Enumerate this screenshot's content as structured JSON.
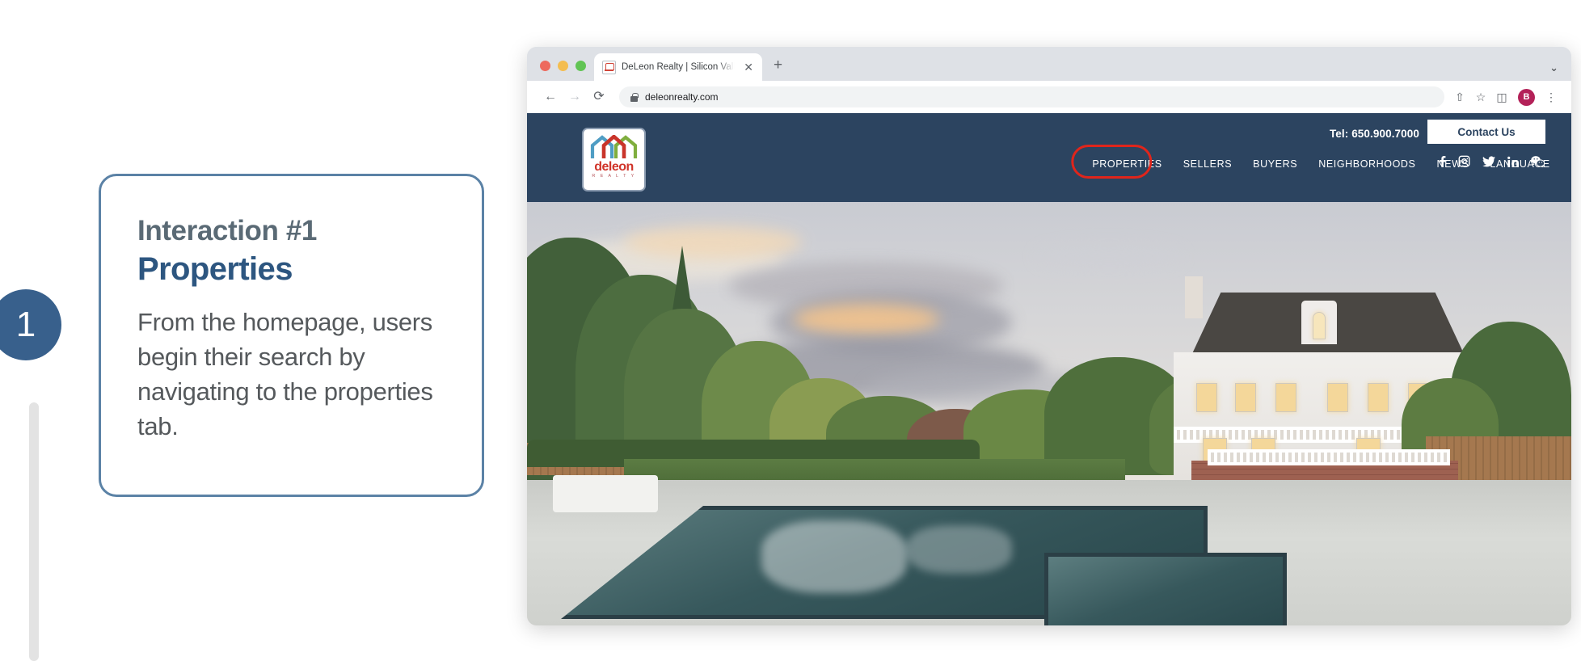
{
  "callout": {
    "badge_number": "1",
    "eyebrow": "Interaction #1",
    "title": "Properties",
    "body": "From the homepage, users begin their search by navigating to the properties tab.",
    "accent_color": "#38608c",
    "border_color": "#5b82a6",
    "title_color": "#2d5680"
  },
  "browser": {
    "traffic_lights": [
      "close",
      "minimize",
      "maximize"
    ],
    "tab": {
      "title": "DeLeon Realty | Silicon Valley R",
      "favicon": "deleon-favicon",
      "close_label": "✕"
    },
    "new_tab_label": "+",
    "tabstrip_chevron": "⌄",
    "toolbar": {
      "back_label": "←",
      "forward_label": "→",
      "reload_label": "⟳",
      "lock_icon": "lock-icon",
      "url": "deleonrealty.com",
      "share_label": "⇧",
      "bookmark_label": "☆",
      "sidebar_label": "◫",
      "profile_initial": "B",
      "menu_label": "⋮"
    }
  },
  "site": {
    "header_bg": "#2c4460",
    "logo": {
      "wordmark": "deleon",
      "subtext": "R E A L T Y",
      "house_colors": [
        "#4f9dc4",
        "#c9342a",
        "#7fae3e"
      ]
    },
    "nav": [
      {
        "label": "PROPERTIES",
        "active": true
      },
      {
        "label": "SELLERS",
        "active": false
      },
      {
        "label": "BUYERS",
        "active": false
      },
      {
        "label": "NEIGHBORHOODS",
        "active": false
      },
      {
        "label": "NEWS",
        "active": false
      },
      {
        "label": "LANGUAGE",
        "active": false
      }
    ],
    "search_icon": "search-icon",
    "highlight_color": "#e0251b",
    "telephone": "Tel: 650.900.7000",
    "contact_button": "Contact Us",
    "social": [
      {
        "name": "facebook"
      },
      {
        "name": "instagram"
      },
      {
        "name": "twitter"
      },
      {
        "name": "linkedin"
      },
      {
        "name": "wechat"
      }
    ],
    "hero_alt": "Luxury estate home at dusk with swimming pool"
  }
}
